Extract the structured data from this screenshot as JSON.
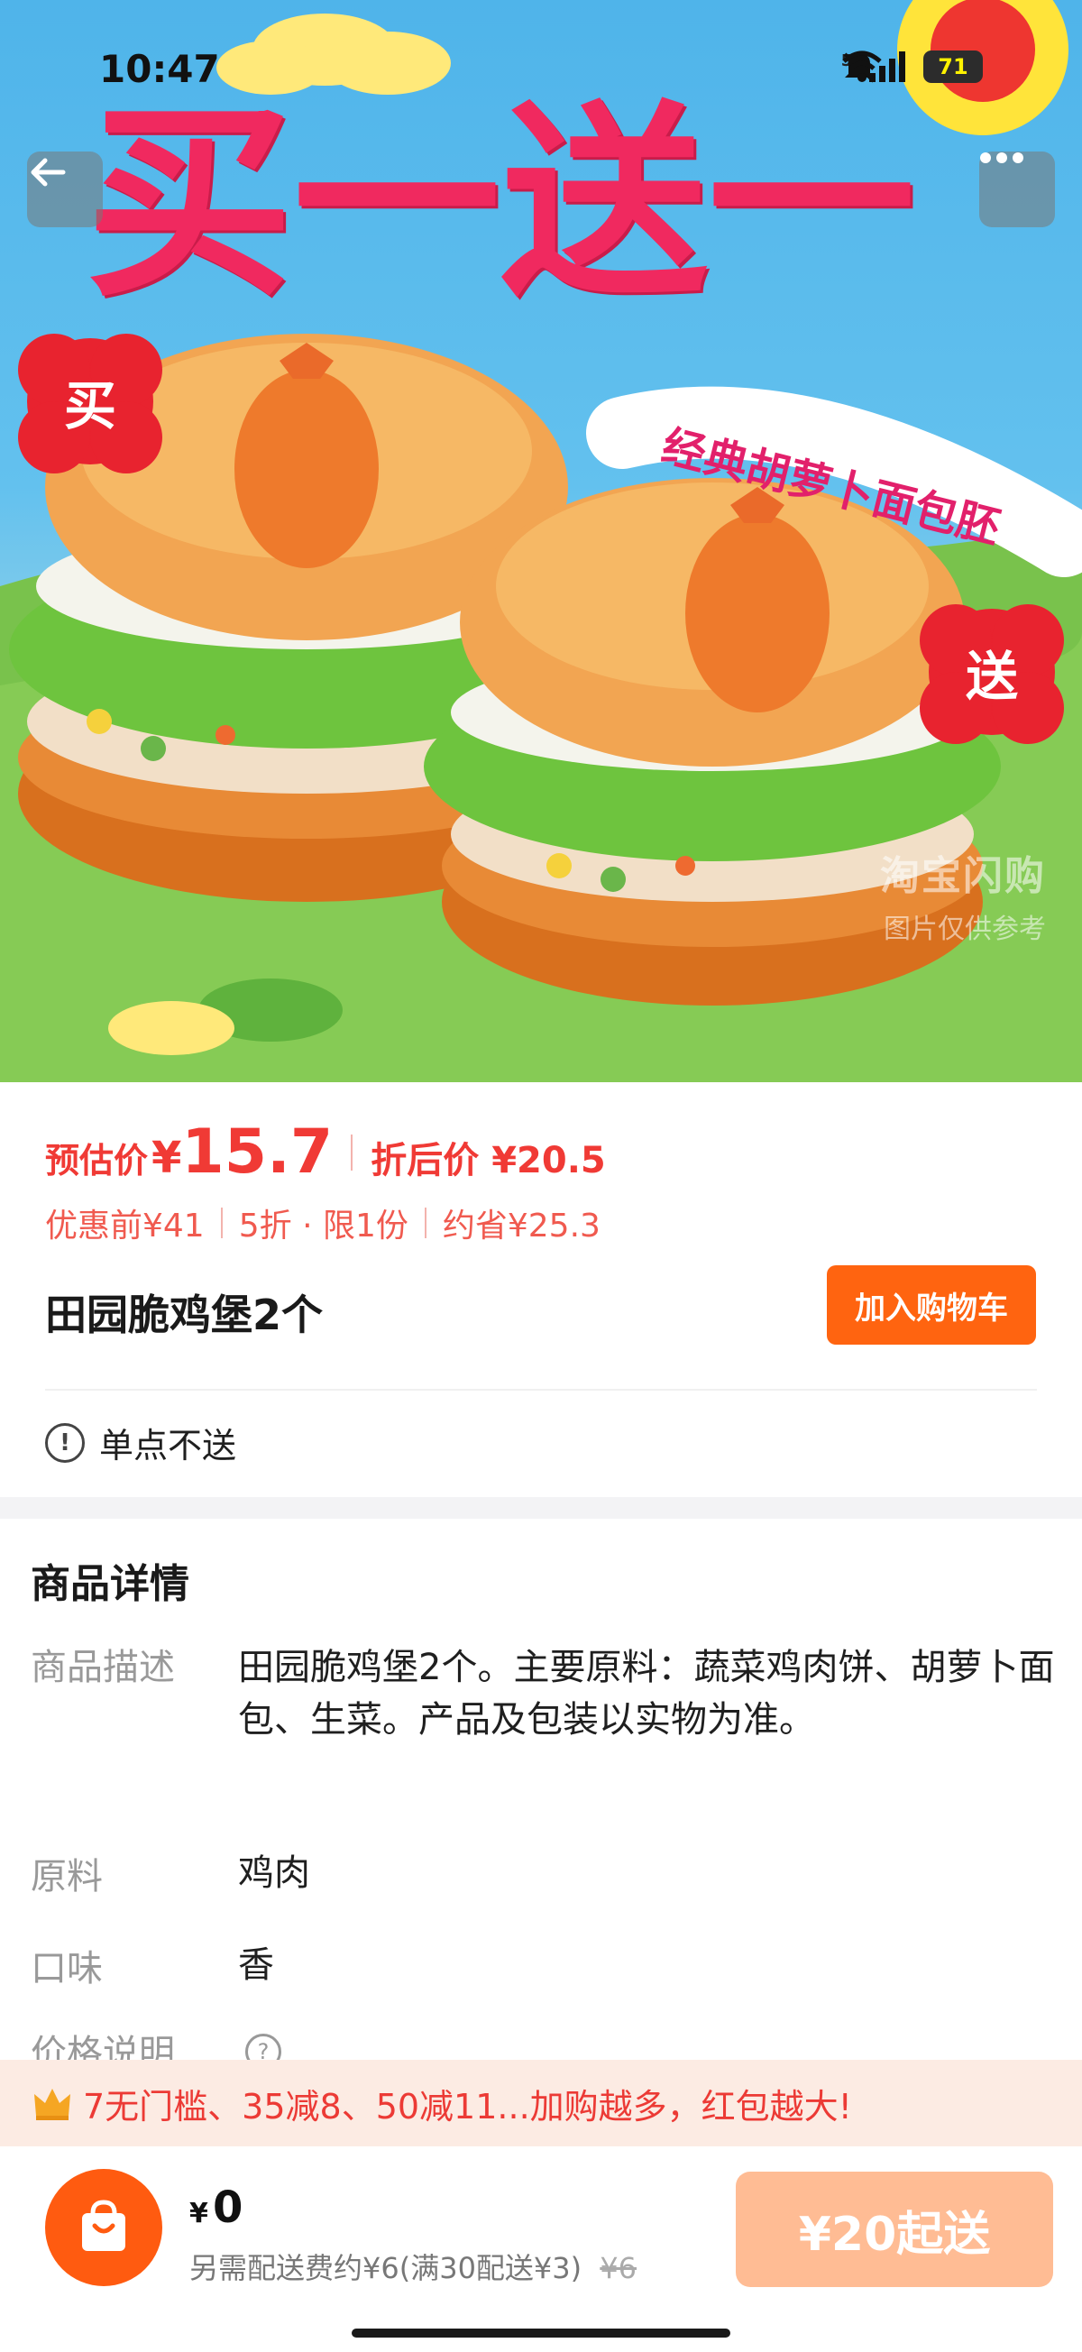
{
  "status_bar": {
    "time": "10:47",
    "network": "5G",
    "battery": "71"
  },
  "hero": {
    "headline": "买一送一",
    "badge_buy": "买",
    "badge_gift": "送",
    "tagline": "经典胡萝卜面包胚",
    "watermark_brand": "淘宝闪购",
    "watermark_note": "图片仅供参考"
  },
  "price": {
    "estimate_label": "预估价",
    "estimate_yen": "¥",
    "estimate_value": "15.7",
    "discount_label": "折后价",
    "discount_value": "¥20.5",
    "original": "优惠前¥41",
    "discount_rate": "5折 · 限1份",
    "saved": "约省¥25.3"
  },
  "product": {
    "title": "田园脆鸡堡2个",
    "add_to_cart": "加入购物车",
    "notice": "单点不送",
    "notice_icon": "!"
  },
  "details": {
    "heading": "商品详情",
    "rows": [
      {
        "key": "商品描述",
        "value": "田园脆鸡堡2个。主要原料：蔬菜鸡肉饼、胡萝卜面包、生菜。产品及包装以实物为准。"
      },
      {
        "key": "原料",
        "value": "鸡肉"
      },
      {
        "key": "口味",
        "value": "香"
      },
      {
        "key": "价格说明",
        "value": "?"
      }
    ]
  },
  "promo": {
    "text": "7无门槛、35减8、50减11...加购越多，红包越大!"
  },
  "bottom": {
    "yen": "¥",
    "total": "0",
    "fee_text": "另需配送费约¥6(满30配送¥3)",
    "fee_original": "¥6",
    "min_order": "¥20起送"
  },
  "colors": {
    "accent": "#ff6410",
    "price_red": "#f03a35",
    "headline_pink": "#f0295f"
  }
}
